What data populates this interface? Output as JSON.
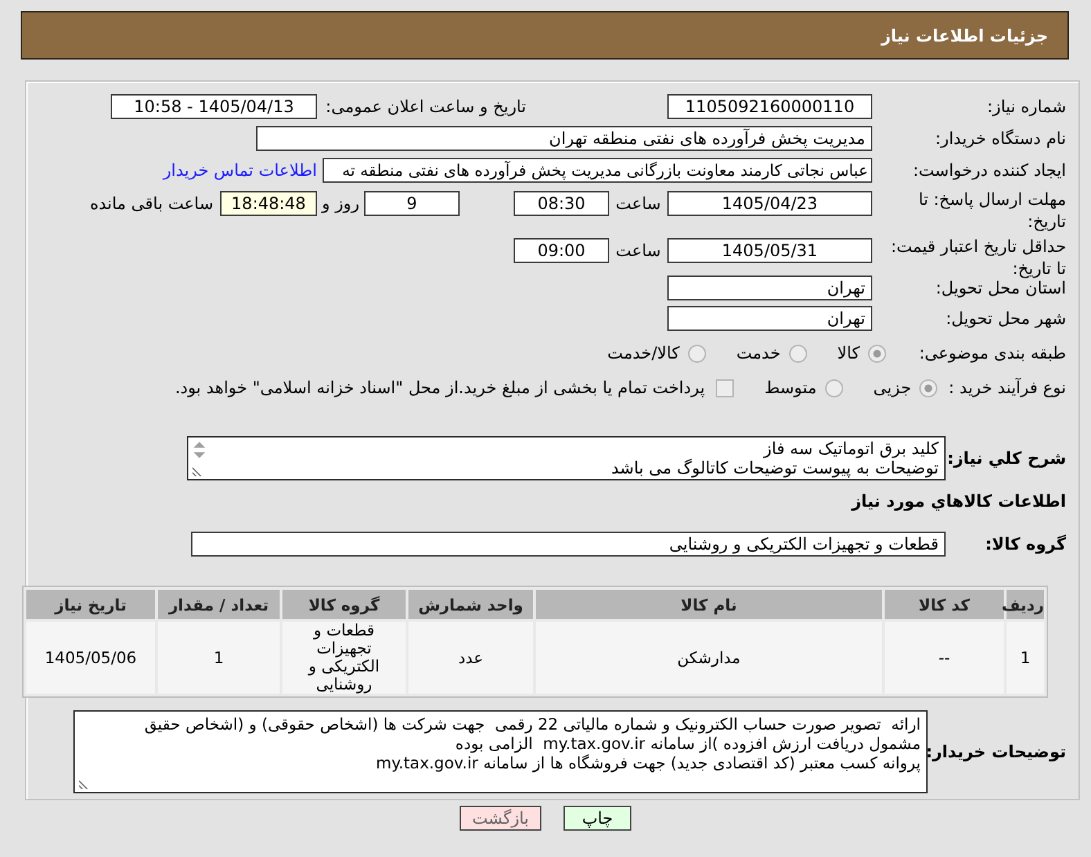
{
  "header": {
    "title": "جزئیات اطلاعات نیاز"
  },
  "need_number": {
    "label": "شماره نیاز:",
    "value": "1105092160000110"
  },
  "announce_datetime": {
    "label": "تاریخ و ساعت اعلان عمومی:",
    "value": "1405/04/13 - 10:58"
  },
  "buyer_org": {
    "label": "نام دستگاه خریدار:",
    "value": "مدیریت پخش فرآورده های نفتی منطقه تهران"
  },
  "requester": {
    "label": "ایجاد کننده درخواست:",
    "value": "عباس نجاتی کارمند معاونت بازرگانی مدیریت پخش فرآورده های نفتی منطقه ته",
    "contact_link": "اطلاعات تماس خریدار"
  },
  "response_deadline": {
    "label": "مهلت ارسال پاسخ: تا تاریخ:",
    "date": "1405/04/23",
    "time_label": "ساعت",
    "time": "08:30",
    "days": "9",
    "days_label": "روز و",
    "remaining": "18:48:48",
    "remaining_label": "ساعت باقی مانده"
  },
  "price_validity": {
    "label": "حداقل تاریخ اعتبار قیمت: تا تاریخ:",
    "date": "1405/05/31",
    "time_label": "ساعت",
    "time": "09:00"
  },
  "delivery_province": {
    "label": "استان محل تحویل:",
    "value": "تهران"
  },
  "delivery_city": {
    "label": "شهر محل تحویل:",
    "value": "تهران"
  },
  "category": {
    "label": "طبقه بندی موضوعی:",
    "options": [
      {
        "label": "کالا",
        "selected": true
      },
      {
        "label": "خدمت",
        "selected": false
      },
      {
        "label": "کالا/خدمت",
        "selected": false
      }
    ]
  },
  "purchase_type": {
    "label": "نوع فرآیند خرید :",
    "options": [
      {
        "label": "جزیی",
        "selected": true
      },
      {
        "label": "متوسط",
        "selected": false
      }
    ],
    "treasury": {
      "label": "پرداخت تمام یا بخشی از مبلغ خرید.از محل \"اسناد خزانه اسلامی\" خواهد بود.",
      "checked": false
    }
  },
  "description": {
    "label": "شرح کلي نیاز:",
    "value": "کلید برق اتوماتیک سه فاز\nتوضیحات به پیوست توضیحات کاتالوگ می باشد"
  },
  "goods_section": {
    "title": "اطلاعات کالاهاي مورد نیاز",
    "group_label": "گروه کالا:",
    "group_value": "قطعات و تجهیزات الکتریکی و روشنایی"
  },
  "table": {
    "columns": [
      "ردیف",
      "کد کالا",
      "نام کالا",
      "واحد شمارش",
      "گروه کالا",
      "تعداد / مقدار",
      "تاریخ نیاز"
    ],
    "rows": [
      [
        "1",
        "--",
        "مدارشکن",
        "عدد",
        "قطعات و تجهیزات الکتریکی و روشنایی",
        "1",
        "1405/05/06"
      ]
    ]
  },
  "buyer_notes": {
    "label": "توضیحات خریدار:",
    "value": "ارائه  تصویر صورت حساب الکترونیک و شماره مالیاتی 22 رقمی  جهت شرکت ها (اشخاص حقوقی) و (اشخاص حقیق\nمشمول دریافت ارزش افزوده )از سامانه my.tax.gov.ir  الزامی بوده\nپروانه کسب معتبر (کد اقتصادی جدید) جهت فروشگاه ها از سامانه my.tax.gov.ir"
  },
  "buttons": [
    {
      "label": "چاپ",
      "kind": "print"
    },
    {
      "label": "بازگشت",
      "kind": "back"
    }
  ]
}
